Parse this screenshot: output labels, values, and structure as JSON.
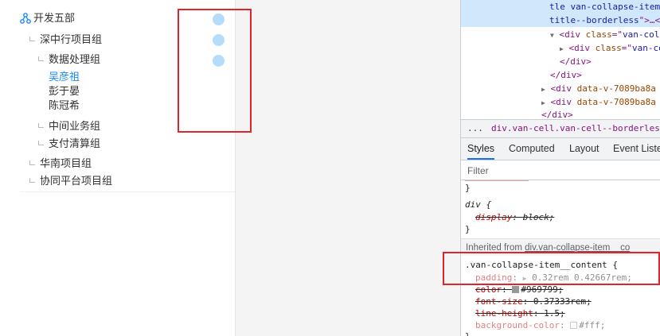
{
  "tree": {
    "items": [
      {
        "label": "开发五部"
      },
      {
        "label": "深中行项目组"
      },
      {
        "label": "数据处理组"
      },
      {
        "label": "吴彦祖"
      },
      {
        "label": "彭于晏"
      },
      {
        "label": "陈冠希"
      },
      {
        "label": "中间业务组"
      },
      {
        "label": "支付清算组"
      },
      {
        "label": "华南项目组"
      },
      {
        "label": "协同平台项目组"
      }
    ],
    "active_color": "#1989fa",
    "dot_color": "#b6dcfb"
  },
  "devtools": {
    "dom": {
      "line1": {
        "a": "tle van-collapse-item",
        "b": ""
      },
      "line2": {
        "a": "title--borderless",
        "b": "\">…<"
      },
      "line3": {
        "tag_open": "<div ",
        "attr": "class",
        "eq": "=\"",
        "val": "van-coll"
      },
      "line4": {
        "tag_open": "<div ",
        "attr": "class",
        "eq": "=\"",
        "val": "van-co"
      },
      "line5": {
        "text": "</div>"
      },
      "line6": {
        "text": "</div>"
      },
      "line7": {
        "tag_open": "<div ",
        "attr": "data-v-7089ba8a",
        "rest": " d"
      },
      "line8": {
        "tag_open": "<div ",
        "attr": "data-v-7089ba8a",
        "rest": " d"
      },
      "line9": {
        "text": "</div>"
      }
    },
    "breadcrumb": {
      "ellipsis": "...",
      "path": "div.van-cell.van-cell--borderless.van-colla"
    },
    "tabs": [
      "Styles",
      "Computed",
      "Layout",
      "Event Listen"
    ],
    "filter_placeholder": "Filter",
    "css": {
      "close1": "}",
      "div_selector": "div {",
      "display_prop": "display",
      "display_val": "block;",
      "close2": "}",
      "inherited_label": "Inherited from ",
      "inherited_link": "div.van-collapse-item__co",
      "rule_selector": ".van-collapse-item__content {",
      "padding_prop": "padding",
      "padding_val": "0.32rem 0.42667rem;",
      "color_prop": "color",
      "color_val": "#969799;",
      "font_size_prop": "font-size",
      "font_size_val": "0.37333rem;",
      "line_height_prop": "line-height",
      "line_height_val": "1.5;",
      "bg_prop": "background-color",
      "bg_val": "#fff;",
      "close3": "}"
    },
    "colors": {
      "highlight": "#e0242b",
      "selected_row": "#cfe8fc",
      "swatch_gray": "#969799"
    }
  }
}
